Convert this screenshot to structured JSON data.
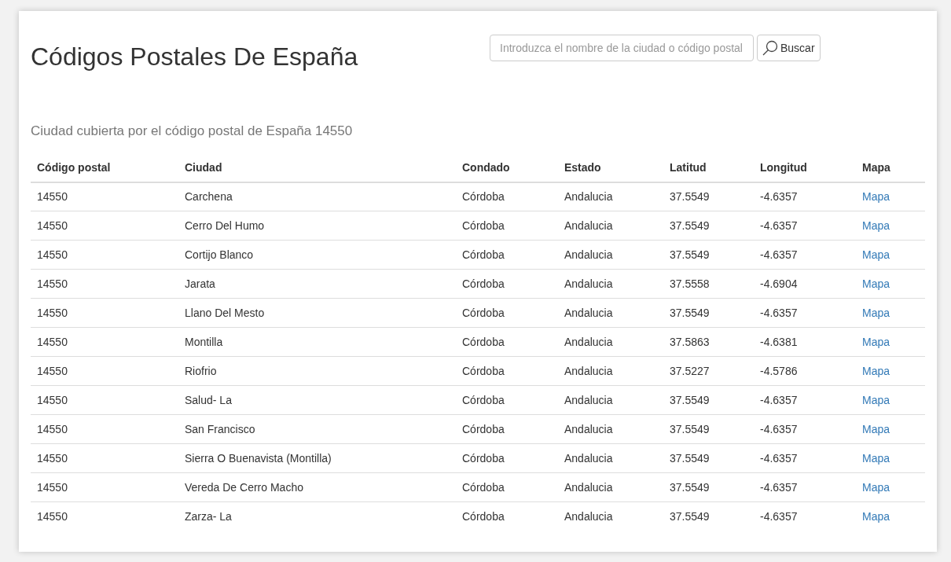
{
  "title": "Códigos Postales De España",
  "search": {
    "placeholder": "Introduzca el nombre de la ciudad o código postal",
    "button": "Buscar"
  },
  "subtitle": "Ciudad cubierta por el código postal de España 14550",
  "table": {
    "columns": [
      "Código postal",
      "Ciudad",
      "Condado",
      "Estado",
      "Latitud",
      "Longitud",
      "Mapa"
    ],
    "rows": [
      [
        "14550",
        "Carchena",
        "Córdoba",
        "Andalucia",
        "37.5549",
        "-4.6357",
        "Mapa"
      ],
      [
        "14550",
        "Cerro Del Humo",
        "Córdoba",
        "Andalucia",
        "37.5549",
        "-4.6357",
        "Mapa"
      ],
      [
        "14550",
        "Cortijo Blanco",
        "Córdoba",
        "Andalucia",
        "37.5549",
        "-4.6357",
        "Mapa"
      ],
      [
        "14550",
        "Jarata",
        "Córdoba",
        "Andalucia",
        "37.5558",
        "-4.6904",
        "Mapa"
      ],
      [
        "14550",
        "Llano Del Mesto",
        "Córdoba",
        "Andalucia",
        "37.5549",
        "-4.6357",
        "Mapa"
      ],
      [
        "14550",
        "Montilla",
        "Córdoba",
        "Andalucia",
        "37.5863",
        "-4.6381",
        "Mapa"
      ],
      [
        "14550",
        "Riofrio",
        "Córdoba",
        "Andalucia",
        "37.5227",
        "-4.5786",
        "Mapa"
      ],
      [
        "14550",
        "Salud- La",
        "Córdoba",
        "Andalucia",
        "37.5549",
        "-4.6357",
        "Mapa"
      ],
      [
        "14550",
        "San Francisco",
        "Córdoba",
        "Andalucia",
        "37.5549",
        "-4.6357",
        "Mapa"
      ],
      [
        "14550",
        "Sierra O Buenavista (Montilla)",
        "Córdoba",
        "Andalucia",
        "37.5549",
        "-4.6357",
        "Mapa"
      ],
      [
        "14550",
        "Vereda De Cerro Macho",
        "Córdoba",
        "Andalucia",
        "37.5549",
        "-4.6357",
        "Mapa"
      ],
      [
        "14550",
        "Zarza- La",
        "Córdoba",
        "Andalucia",
        "37.5549",
        "-4.6357",
        "Mapa"
      ]
    ]
  }
}
